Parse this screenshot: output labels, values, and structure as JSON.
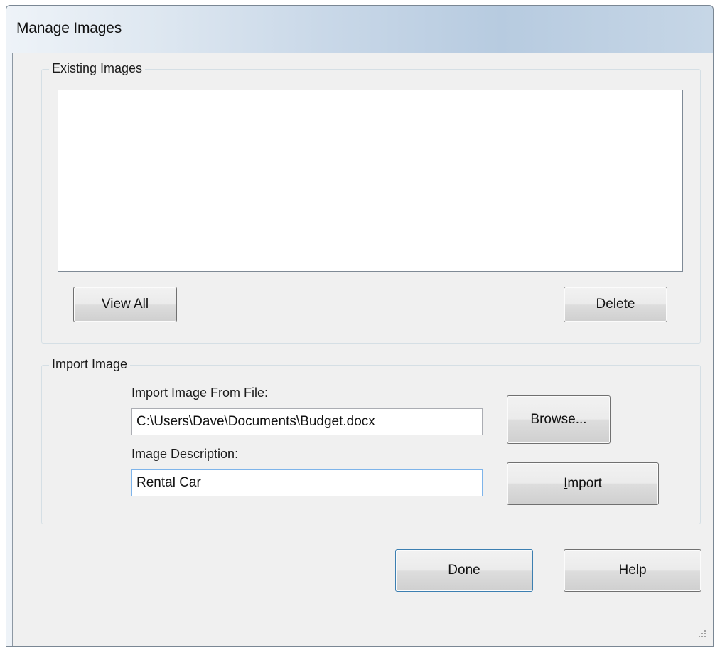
{
  "window": {
    "title": "Manage Images"
  },
  "existing_images": {
    "legend": "Existing Images",
    "items": [],
    "view_all_label": "View All",
    "view_all_mnemonic_index": 5,
    "delete_label": "Delete",
    "delete_mnemonic_index": 0
  },
  "import_image": {
    "legend": "Import Image",
    "file_label": "Import Image From File:",
    "file_value": "C:\\Users\\Dave\\Documents\\Budget.docx",
    "browse_label": "Browse...",
    "description_label": "Image Description:",
    "description_value": "Rental Car",
    "import_label": "Import",
    "import_mnemonic_index": 0
  },
  "footer": {
    "done_label": "Done",
    "done_mnemonic_index": 3,
    "help_label": "Help",
    "help_mnemonic_index": 0
  },
  "icons": {
    "resize_grip": "resize-grip-icon"
  }
}
